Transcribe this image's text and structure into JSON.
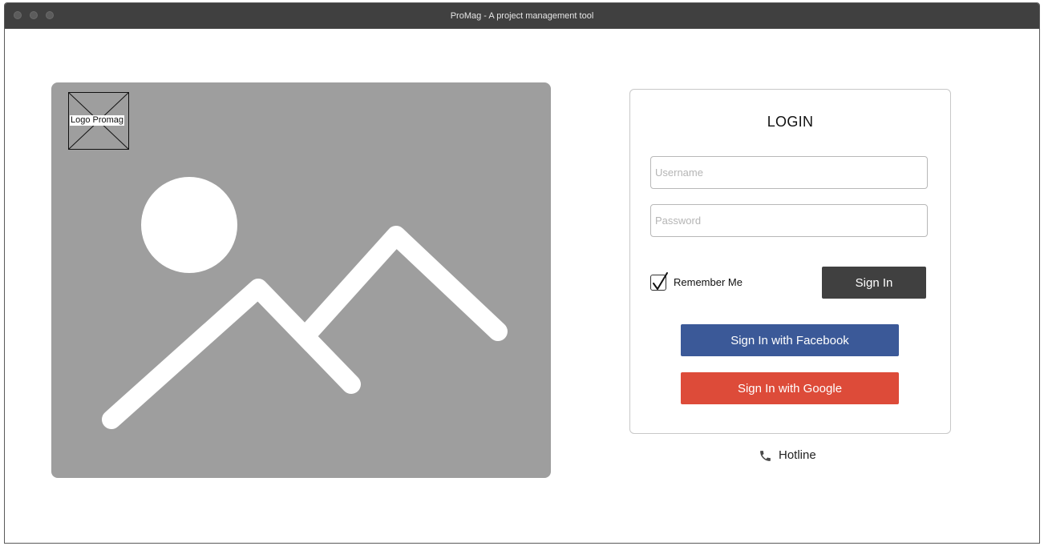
{
  "window": {
    "title": "ProMag - A project management tool"
  },
  "hero": {
    "logo_label": "Logo Promag",
    "image_icon": "image-placeholder-icon"
  },
  "login": {
    "title": "LOGIN",
    "username_placeholder": "Username",
    "password_placeholder": "Password",
    "remember_label": "Remember Me",
    "remember_checked": true,
    "signin_label": "Sign In",
    "facebook_label": "Sign In with Facebook",
    "google_label": "Sign In with Google"
  },
  "hotline": {
    "label": "Hotline",
    "icon": "phone-icon"
  },
  "colors": {
    "titlebar": "#404040",
    "placeholder_image": "#9e9e9e",
    "signin": "#404040",
    "facebook": "#3b5998",
    "google": "#dd4b39"
  }
}
